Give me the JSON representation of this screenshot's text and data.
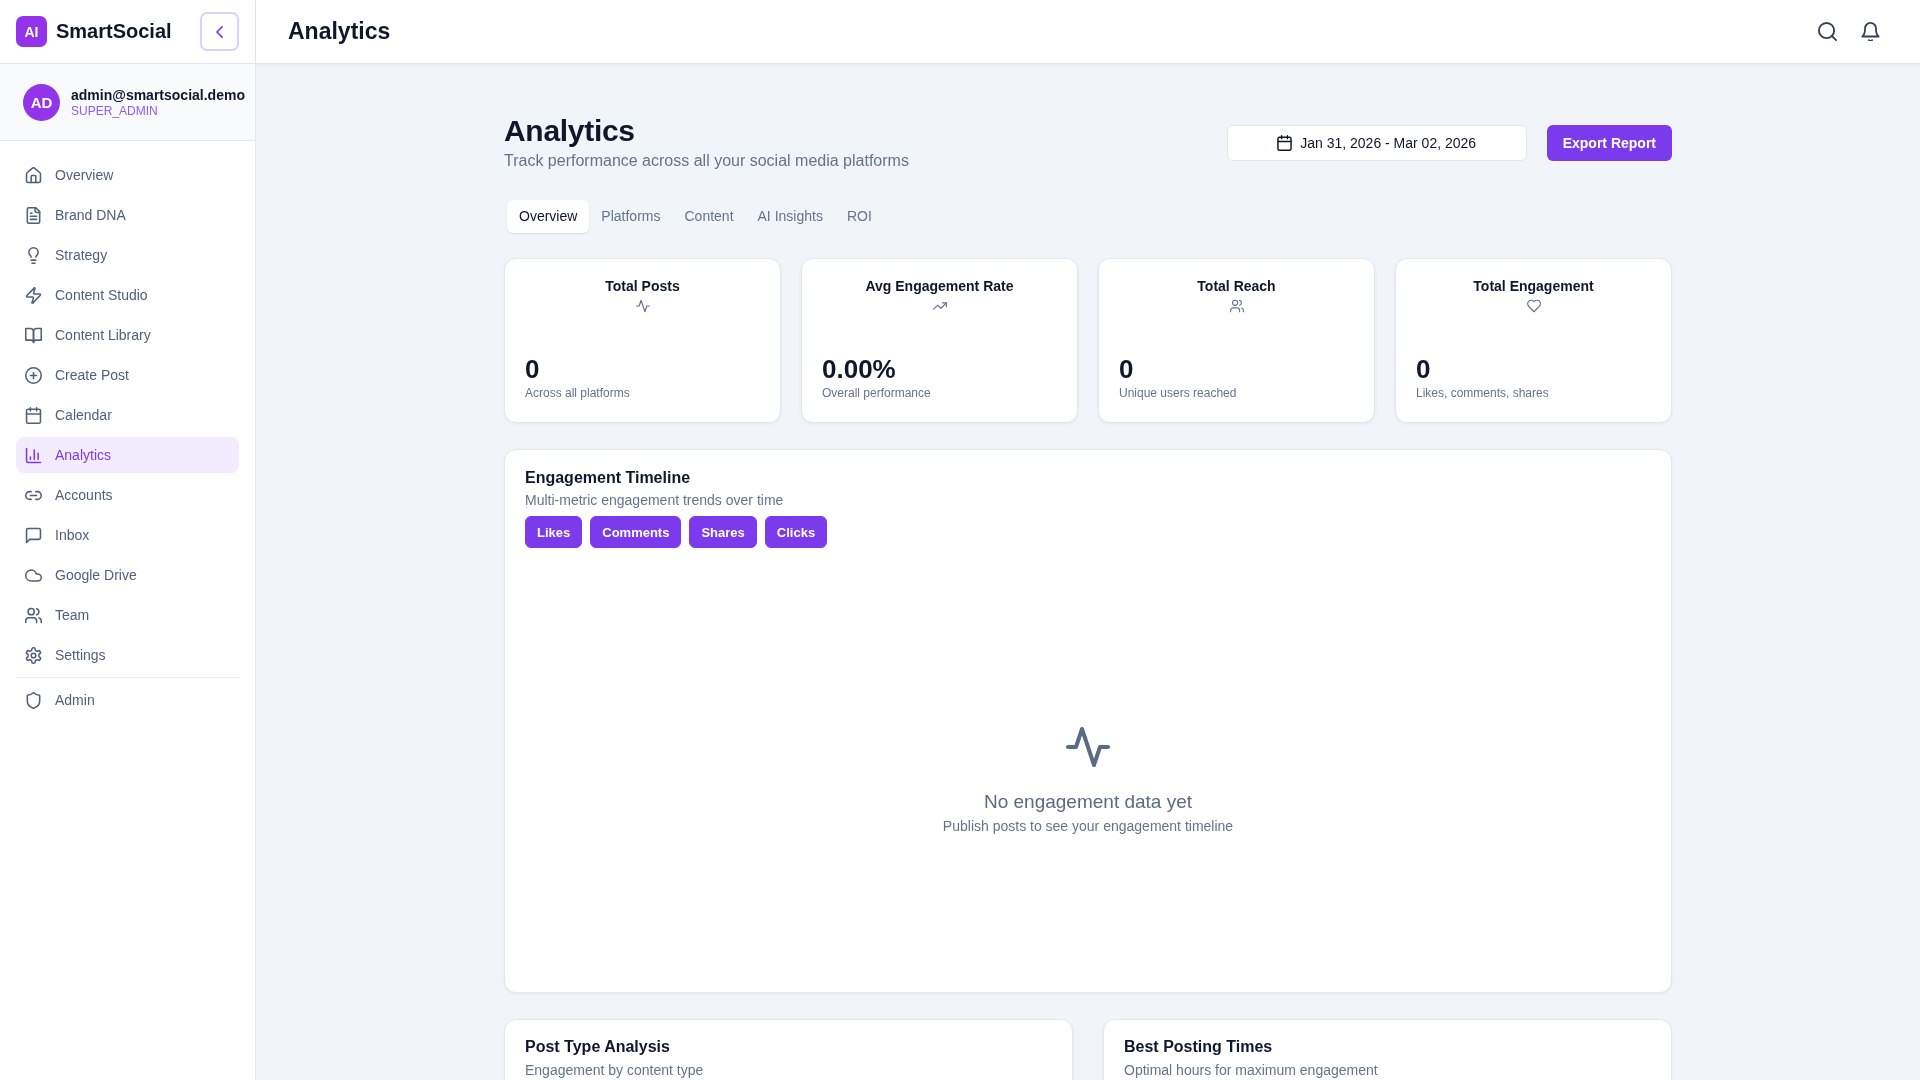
{
  "sidebar": {
    "brand": {
      "badge": "AI",
      "name": "SmartSocial"
    },
    "user": {
      "initials": "AD",
      "email": "admin@smartsocial.demo",
      "role": "SUPER_ADMIN"
    },
    "nav": [
      {
        "label": "Overview",
        "selected": false
      },
      {
        "label": "Brand DNA",
        "selected": false
      },
      {
        "label": "Strategy",
        "selected": false
      },
      {
        "label": "Content Studio",
        "selected": false
      },
      {
        "label": "Content Library",
        "selected": false
      },
      {
        "label": "Create Post",
        "selected": false
      },
      {
        "label": "Calendar",
        "selected": false
      },
      {
        "label": "Analytics",
        "selected": true
      },
      {
        "label": "Accounts",
        "selected": false
      },
      {
        "label": "Inbox",
        "selected": false
      },
      {
        "label": "Google Drive",
        "selected": false
      },
      {
        "label": "Team",
        "selected": false
      },
      {
        "label": "Settings",
        "selected": false
      }
    ],
    "admin_nav": [
      {
        "label": "Admin",
        "selected": false
      }
    ]
  },
  "header": {
    "title": "Analytics"
  },
  "page": {
    "title": "Analytics",
    "subtitle": "Track performance across all your social media platforms",
    "date_range": "Jan 31, 2026 - Mar 02, 2026",
    "export_button": "Export Report"
  },
  "tabs": [
    {
      "label": "Overview",
      "selected": true
    },
    {
      "label": "Platforms",
      "selected": false
    },
    {
      "label": "Content",
      "selected": false
    },
    {
      "label": "AI Insights",
      "selected": false
    },
    {
      "label": "ROI",
      "selected": false
    }
  ],
  "stats": [
    {
      "title": "Total Posts",
      "value": "0",
      "caption": "Across all platforms"
    },
    {
      "title": "Avg Engagement Rate",
      "value": "0.00%",
      "caption": "Overall performance"
    },
    {
      "title": "Total Reach",
      "value": "0",
      "caption": "Unique users reached"
    },
    {
      "title": "Total Engagement",
      "value": "0",
      "caption": "Likes, comments, shares"
    }
  ],
  "engagement_timeline": {
    "title": "Engagement Timeline",
    "subtitle": "Multi-metric engagement trends over time",
    "metrics": [
      {
        "label": "Likes",
        "selected": true
      },
      {
        "label": "Comments",
        "selected": true
      },
      {
        "label": "Shares",
        "selected": true
      },
      {
        "label": "Clicks",
        "selected": true
      }
    ],
    "empty_state": {
      "title": "No engagement data yet",
      "message": "Publish posts to see your engagement timeline"
    }
  },
  "bottom_cards": [
    {
      "title": "Post Type Analysis",
      "subtitle": "Engagement by content type"
    },
    {
      "title": "Best Posting Times",
      "subtitle": "Optimal hours for maximum engagement"
    }
  ]
}
